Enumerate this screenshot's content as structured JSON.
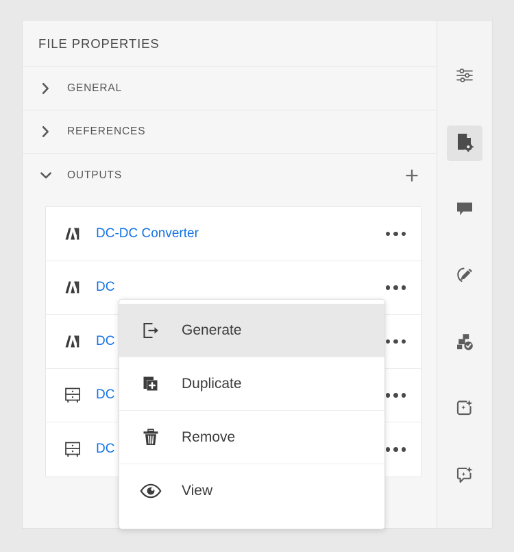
{
  "panel": {
    "title": "FILE PROPERTIES"
  },
  "sections": [
    {
      "label": "GENERAL",
      "icon": "chevron-right-icon",
      "expanded": false,
      "has_add": false
    },
    {
      "label": "REFERENCES",
      "icon": "chevron-right-icon",
      "expanded": false,
      "has_add": false
    },
    {
      "label": "OUTPUTS",
      "icon": "chevron-down-icon",
      "expanded": true,
      "has_add": true,
      "add_icon": "plus-icon"
    }
  ],
  "outputs": {
    "add_label": "+",
    "rows": [
      {
        "name": "DC-DC Converter",
        "icon": "altium-document-icon",
        "more_icon": "more-horizontal-icon"
      },
      {
        "name": "DC",
        "icon": "altium-document-icon",
        "more_icon": "more-horizontal-icon"
      },
      {
        "name": "DC",
        "icon": "altium-document-icon",
        "more_icon": "more-horizontal-icon"
      },
      {
        "name": "DC",
        "icon": "drawer-cabinet-icon",
        "more_icon": "more-horizontal-icon"
      },
      {
        "name": "DC",
        "icon": "drawer-cabinet-icon",
        "more_icon": "more-horizontal-icon"
      }
    ]
  },
  "context_menu": {
    "items": [
      {
        "label": "Generate",
        "icon": "export-arrow-icon",
        "highlighted": true
      },
      {
        "label": "Duplicate",
        "icon": "duplicate-icon",
        "highlighted": false
      },
      {
        "label": "Remove",
        "icon": "trash-icon",
        "highlighted": false
      },
      {
        "label": "View",
        "icon": "eye-icon",
        "highlighted": false
      }
    ]
  },
  "rail": {
    "items": [
      {
        "icon": "sliders-icon",
        "selected": false
      },
      {
        "icon": "file-properties-icon",
        "selected": true
      },
      {
        "icon": "comment-bubble-icon",
        "selected": false
      },
      {
        "icon": "markup-pencil-icon",
        "selected": false
      },
      {
        "icon": "approvals-check-icon",
        "selected": false
      },
      {
        "icon": "ai-generate-icon",
        "selected": false
      },
      {
        "icon": "ai-chat-icon",
        "selected": false
      }
    ]
  },
  "colors": {
    "link": "#1473E6",
    "text": "#4B4B4B",
    "panel_bg": "#F6F6F6",
    "app_bg": "#E9E9E9",
    "menu_highlight": "#E8E8E8"
  }
}
